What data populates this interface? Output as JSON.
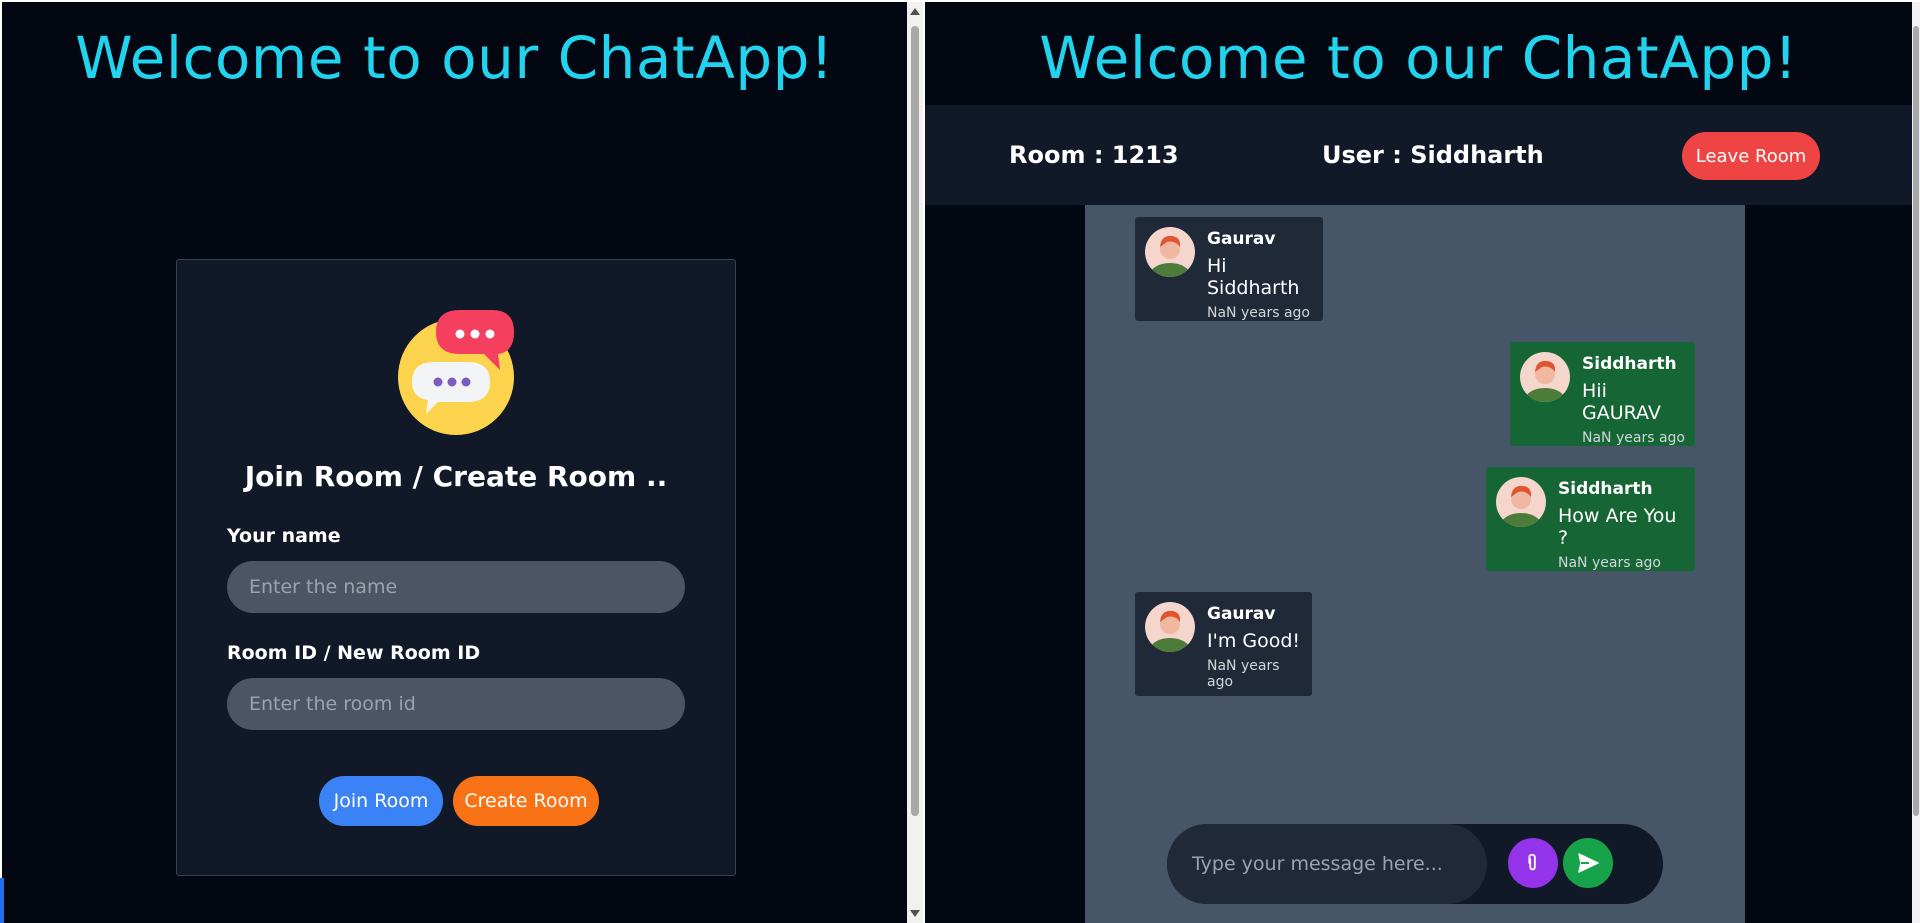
{
  "app": {
    "title": "Welcome to our ChatApp!"
  },
  "join_form": {
    "heading": "Join Room / Create Room ..",
    "name_label": "Your name",
    "name_placeholder": "Enter the name",
    "room_label": "Room ID / New Room ID",
    "room_placeholder": "Enter the room id",
    "join_button": "Join Room",
    "create_button": "Create Room"
  },
  "chat": {
    "room_text": "Room : 1213",
    "user_text": "User : Siddharth",
    "leave_button": "Leave Room",
    "messages": [
      {
        "sender": "Gaurav",
        "text": "Hi Siddharth",
        "time": "NaN years ago",
        "direction": "incoming"
      },
      {
        "sender": "Siddharth",
        "text": "Hii GAURAV",
        "time": "NaN years ago",
        "direction": "outgoing"
      },
      {
        "sender": "Siddharth",
        "text": "How Are You ?",
        "time": "NaN years ago",
        "direction": "outgoing"
      },
      {
        "sender": "Gaurav",
        "text": "I'm Good!",
        "time": "NaN years ago",
        "direction": "incoming"
      }
    ],
    "composer_placeholder": "Type your message here...",
    "icons": {
      "attach": "paperclip-icon",
      "send": "send-icon"
    }
  },
  "colors": {
    "title": "#22d3ee",
    "join_button": "#3b82f6",
    "create_button": "#f97316",
    "leave_button": "#ef4444",
    "outgoing_bubble": "#166534",
    "incoming_bubble": "#1f2937",
    "attach_button": "#9333ea",
    "send_button": "#16a34a"
  }
}
